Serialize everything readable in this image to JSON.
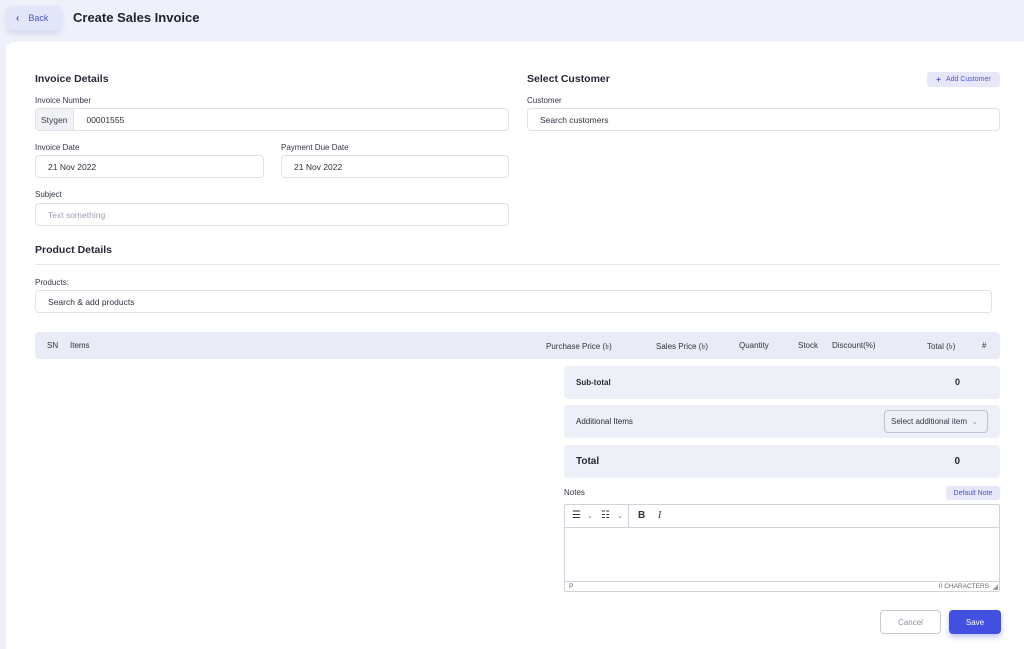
{
  "header": {
    "back_label": "Back",
    "title": "Create Sales Invoice"
  },
  "invoice_details": {
    "title": "Invoice Details",
    "invoice_number_label": "Invoice Number",
    "invoice_prefix": "Stygen",
    "invoice_number": "00001555",
    "invoice_date_label": "Invoice Date",
    "invoice_date": "21 Nov 2022",
    "due_date_label": "Payment Due Date",
    "due_date": "21 Nov 2022",
    "subject_label": "Subject",
    "subject_placeholder": "Text something"
  },
  "customer": {
    "title": "Select Customer",
    "add_label": "Add Customer",
    "customer_label": "Customer",
    "search_placeholder": "Search customers"
  },
  "product_details": {
    "title": "Product Details",
    "products_label": "Products:",
    "search_placeholder": "Search & add products"
  },
  "table": {
    "columns": {
      "sn": "SN",
      "items": "Items",
      "purchase_price": "Purchase Price (৳)",
      "sales_price": "Sales Price (৳)",
      "quantity": "Quantity",
      "stock": "Stock",
      "discount": "Discount(%)",
      "total": "Total (৳)",
      "action": "#"
    }
  },
  "summary": {
    "subtotal_label": "Sub-total",
    "subtotal_value": "0",
    "additional_label": "Additional Items",
    "additional_select": "Select additional item",
    "total_label": "Total",
    "total_value": "0"
  },
  "notes": {
    "label": "Notes",
    "default_note_label": "Default Note",
    "status_tag": "P",
    "char_count": "0 CHARACTERS"
  },
  "actions": {
    "cancel_label": "Cancel",
    "save_label": "Save"
  },
  "colors": {
    "accent": "#4150e0",
    "page_bg": "#eef1f9",
    "soft_accent": "#e6e8fa"
  }
}
